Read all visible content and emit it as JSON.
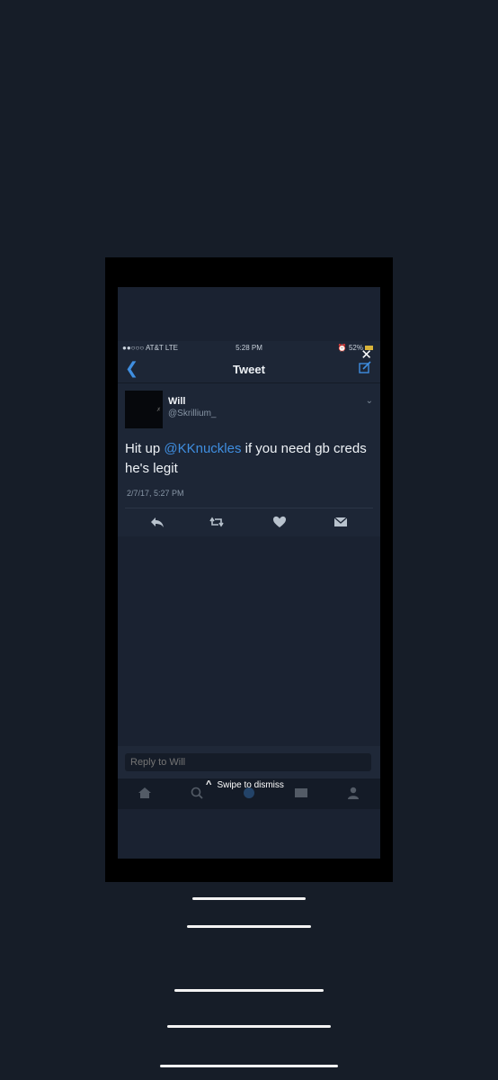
{
  "status_bar": {
    "carrier": "●●○○○ AT&T  LTE",
    "time": "5:28 PM",
    "battery": "52%"
  },
  "nav": {
    "title": "Tweet",
    "back_icon": "chevron-left-icon",
    "compose_icon": "compose-icon",
    "close_icon": "close-icon"
  },
  "tweet": {
    "author_name": "Will",
    "author_handle": "@Skrillium_",
    "text_before": "Hit up ",
    "mention": "@KKnuckles",
    "text_after": " if you need gb creds he's legit",
    "timestamp": "2/7/17, 5:27 PM"
  },
  "reply": {
    "placeholder": "Reply to Will"
  },
  "swipe": {
    "label": "Swipe to dismiss"
  },
  "colors": {
    "background": "#161d28",
    "screen": "#1a2231",
    "accent": "#3f8ee0"
  }
}
